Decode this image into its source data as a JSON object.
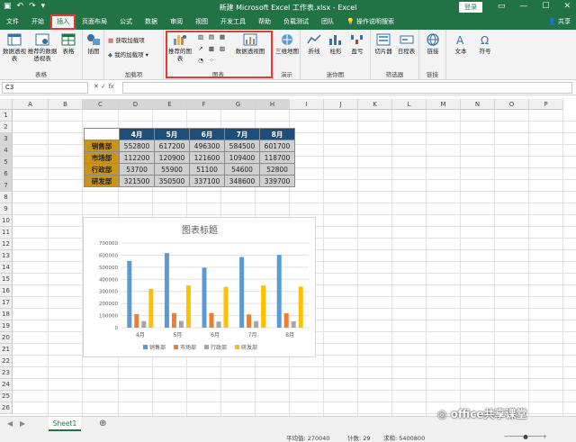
{
  "titlebar": {
    "title": "新建 Microsoft Excel 工作表.xlsx  -  Excel",
    "login": "登录"
  },
  "tabs": [
    "文件",
    "开始",
    "插入",
    "页面布局",
    "公式",
    "数据",
    "审阅",
    "视图",
    "开发工具",
    "帮助",
    "负载测试",
    "团队",
    "操作说明搜索"
  ],
  "active_tab": "插入",
  "share": "共享",
  "ribbon": {
    "groups": [
      {
        "label": "表格",
        "buttons": [
          "数据透视表",
          "推荐的数据透视表",
          "表格"
        ]
      },
      {
        "label": "",
        "buttons": [
          "插图"
        ]
      },
      {
        "label": "加载项",
        "buttons": [
          "获取加载项",
          "我的加载项"
        ]
      },
      {
        "label": "图表",
        "buttons": [
          "推荐的图表",
          "数据透视图"
        ]
      },
      {
        "label": "演示",
        "buttons": [
          "三维地图"
        ]
      },
      {
        "label": "迷你图",
        "buttons": [
          "折线",
          "柱形",
          "盈亏"
        ]
      },
      {
        "label": "筛选器",
        "buttons": [
          "切片器",
          "日程表"
        ]
      },
      {
        "label": "链接",
        "buttons": [
          "链接"
        ]
      },
      {
        "label": "",
        "buttons": [
          "文本",
          "符号"
        ]
      }
    ]
  },
  "formula_bar": {
    "namebox": "C3",
    "fx": "fx",
    "value": ""
  },
  "columns": [
    "A",
    "B",
    "C",
    "D",
    "E",
    "F",
    "G",
    "H",
    "I",
    "J",
    "K",
    "L",
    "M",
    "N",
    "O",
    "P"
  ],
  "rows": [
    "1",
    "2",
    "3",
    "4",
    "5",
    "6",
    "7",
    "8",
    "9",
    "10",
    "11",
    "12",
    "13",
    "14",
    "15",
    "16",
    "17",
    "18",
    "19",
    "20",
    "21",
    "22",
    "23",
    "24",
    "25",
    "26"
  ],
  "table": {
    "headers": [
      "4月",
      "5月",
      "6月",
      "7月",
      "8月"
    ],
    "rows": [
      {
        "dept": "销售部",
        "values": [
          "552800",
          "617200",
          "496300",
          "584500",
          "601700"
        ]
      },
      {
        "dept": "市场部",
        "values": [
          "112200",
          "120900",
          "121600",
          "109400",
          "118700"
        ]
      },
      {
        "dept": "行政部",
        "values": [
          "53700",
          "55900",
          "51100",
          "54600",
          "52800"
        ]
      },
      {
        "dept": "研发部",
        "values": [
          "321500",
          "350500",
          "337100",
          "348600",
          "339700"
        ]
      }
    ]
  },
  "chart_data": {
    "type": "bar",
    "title": "图表标题",
    "categories": [
      "4月",
      "5月",
      "6月",
      "7月",
      "8月"
    ],
    "series": [
      {
        "name": "销售部",
        "values": [
          552800,
          617200,
          496300,
          584500,
          601700
        ],
        "color": "#5b9bd5"
      },
      {
        "name": "市场部",
        "values": [
          112200,
          120900,
          121600,
          109400,
          118700
        ],
        "color": "#ed7d31"
      },
      {
        "name": "行政部",
        "values": [
          53700,
          55900,
          51100,
          54600,
          52800
        ],
        "color": "#a5a5a5"
      },
      {
        "name": "研发部",
        "values": [
          321500,
          350500,
          337100,
          348600,
          339700
        ],
        "color": "#ffc000"
      }
    ],
    "ylim": [
      0,
      700000
    ],
    "yticks": [
      "0",
      "100000",
      "200000",
      "300000",
      "400000",
      "500000",
      "600000",
      "700000"
    ],
    "legend": "bottom",
    "grid": true
  },
  "sheet_tab": "Sheet1",
  "status": {
    "average": "平均值: 270040",
    "count": "计数: 29",
    "sum": "求和: 5400800"
  },
  "watermark": "office共享课堂"
}
